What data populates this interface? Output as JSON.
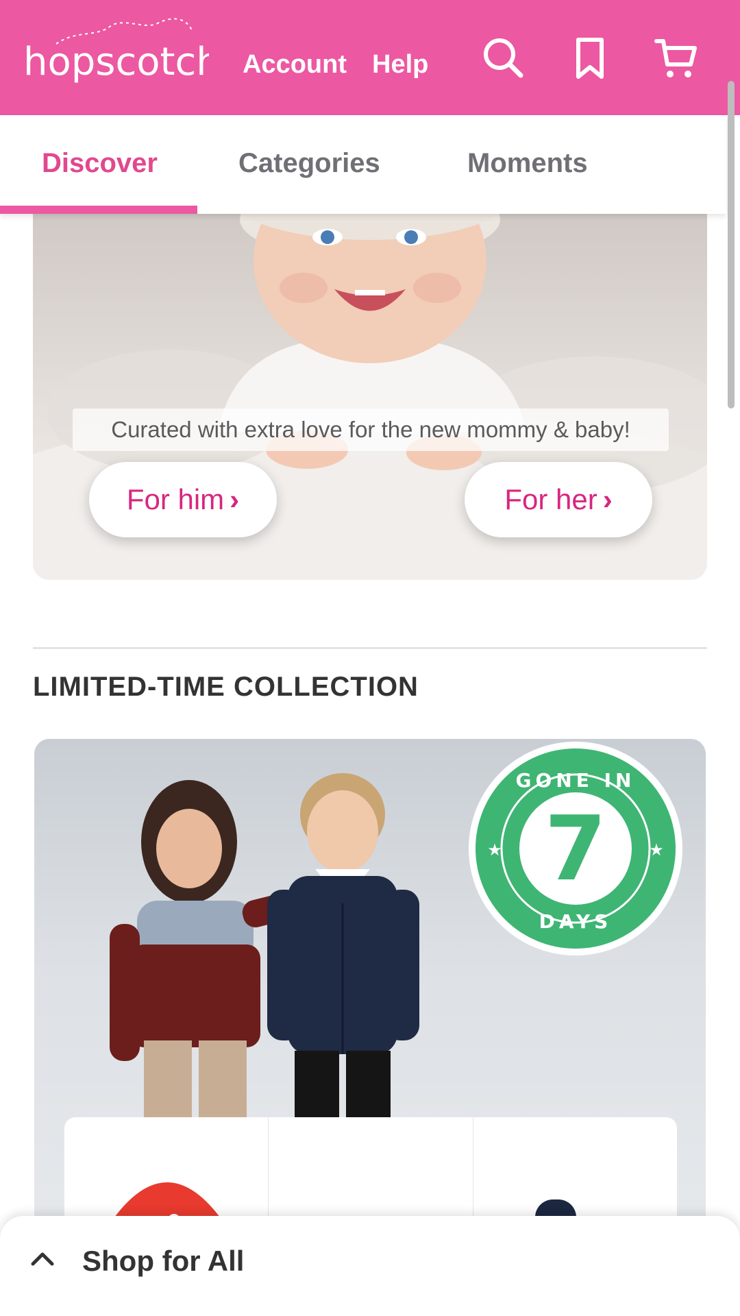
{
  "header": {
    "logo_text": "hopscotch",
    "nav": [
      {
        "label": "Account"
      },
      {
        "label": "Help"
      }
    ],
    "icons": [
      "search-icon",
      "bookmark-icon",
      "cart-icon"
    ],
    "brand_color": "#ec58a2"
  },
  "tabs": {
    "items": [
      {
        "label": "Discover",
        "active": true
      },
      {
        "label": "Categories",
        "active": false
      },
      {
        "label": "Moments",
        "active": false
      }
    ],
    "active_color": "#e1488f"
  },
  "hero": {
    "caption": "Curated with extra love for the new mommy & baby!",
    "buttons": [
      {
        "label": "For him",
        "chevron": "›"
      },
      {
        "label": "For her",
        "chevron": "›"
      }
    ]
  },
  "section": {
    "title": "LIMITED-TIME COLLECTION"
  },
  "collection": {
    "badge": {
      "top_text": "GONE IN",
      "number": "7",
      "bottom_text": "DAYS",
      "color": "#3fb574"
    }
  },
  "bottom_sheet": {
    "label": "Shop for All"
  }
}
